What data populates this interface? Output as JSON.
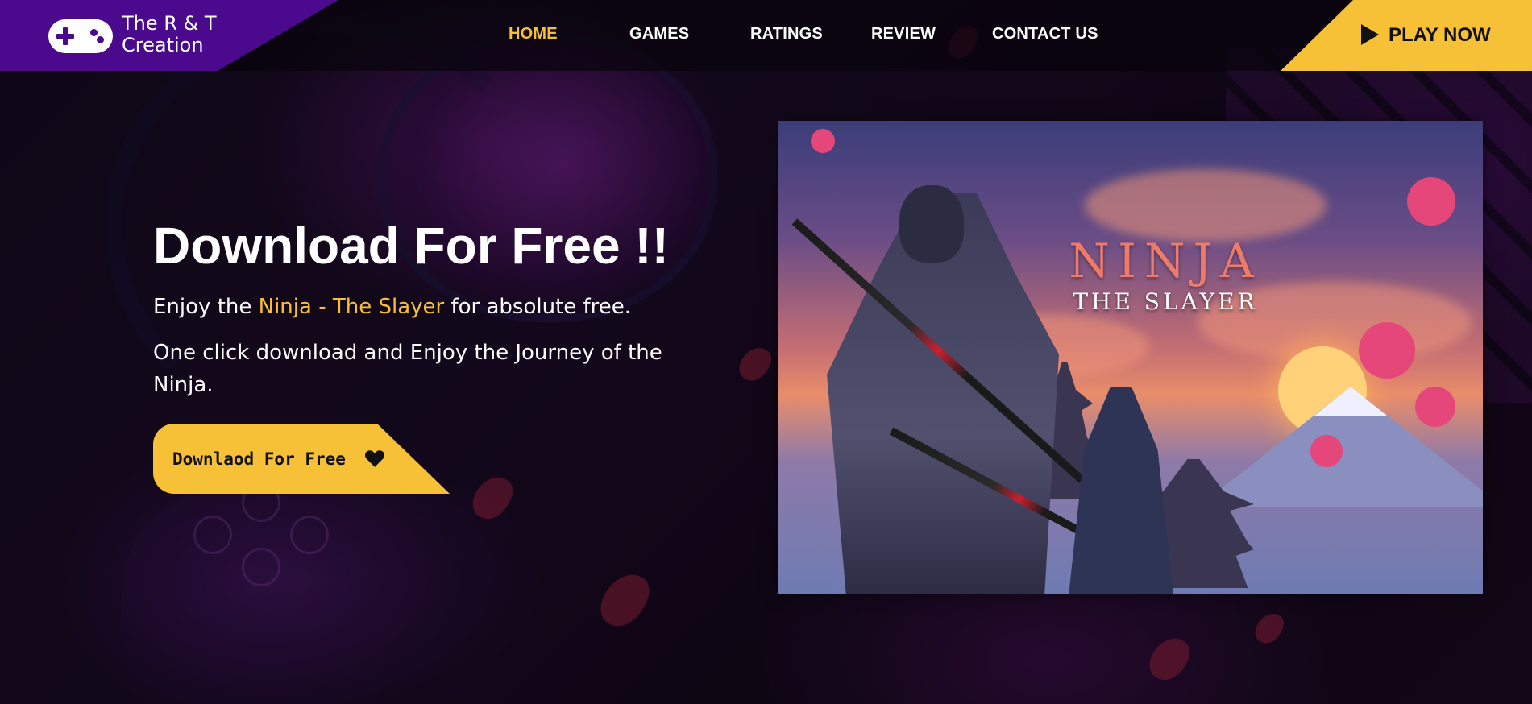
{
  "brand": {
    "name": "The R & T Creation",
    "logo_icon": "gamepad-icon",
    "colors": {
      "brand_purple": "#4b0a8e",
      "accent_yellow": "#f7c137"
    }
  },
  "nav": {
    "items": [
      {
        "label": "HOME",
        "active": true
      },
      {
        "label": "GAMES",
        "active": false
      },
      {
        "label": "RATINGS",
        "active": false
      },
      {
        "label": "REVIEW",
        "active": false
      },
      {
        "label": "CONTACT US",
        "active": false
      }
    ]
  },
  "header": {
    "cta_label": "PLAY NOW",
    "cta_icon": "play-icon"
  },
  "hero": {
    "title": "Download For Free !!",
    "line1_prefix": "Enjoy the ",
    "line1_highlight": "Ninja - The Slayer",
    "line1_suffix": " for absolute free.",
    "line2": "One click download and Enjoy the Journey of the Ninja.",
    "button_label": "Downlaod For Free",
    "button_icon": "heart-icon"
  },
  "game_art": {
    "title": "NINJA",
    "subtitle": "THE SLAYER"
  }
}
